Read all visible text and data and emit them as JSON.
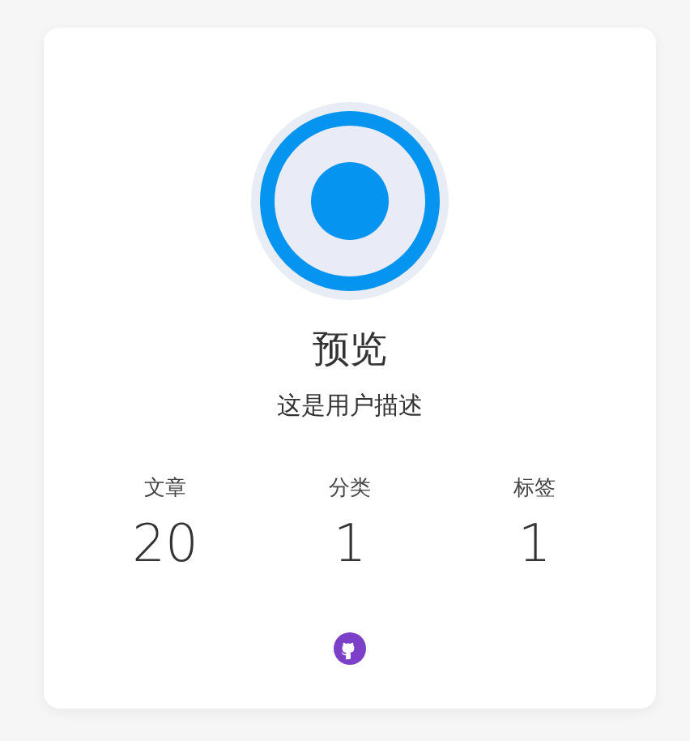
{
  "profile": {
    "name": "预览",
    "description": "这是用户描述"
  },
  "stats": [
    {
      "label": "文章",
      "value": "20"
    },
    {
      "label": "分类",
      "value": "1"
    },
    {
      "label": "标签",
      "value": "1"
    }
  ],
  "links": [
    {
      "kind": "github"
    }
  ]
}
